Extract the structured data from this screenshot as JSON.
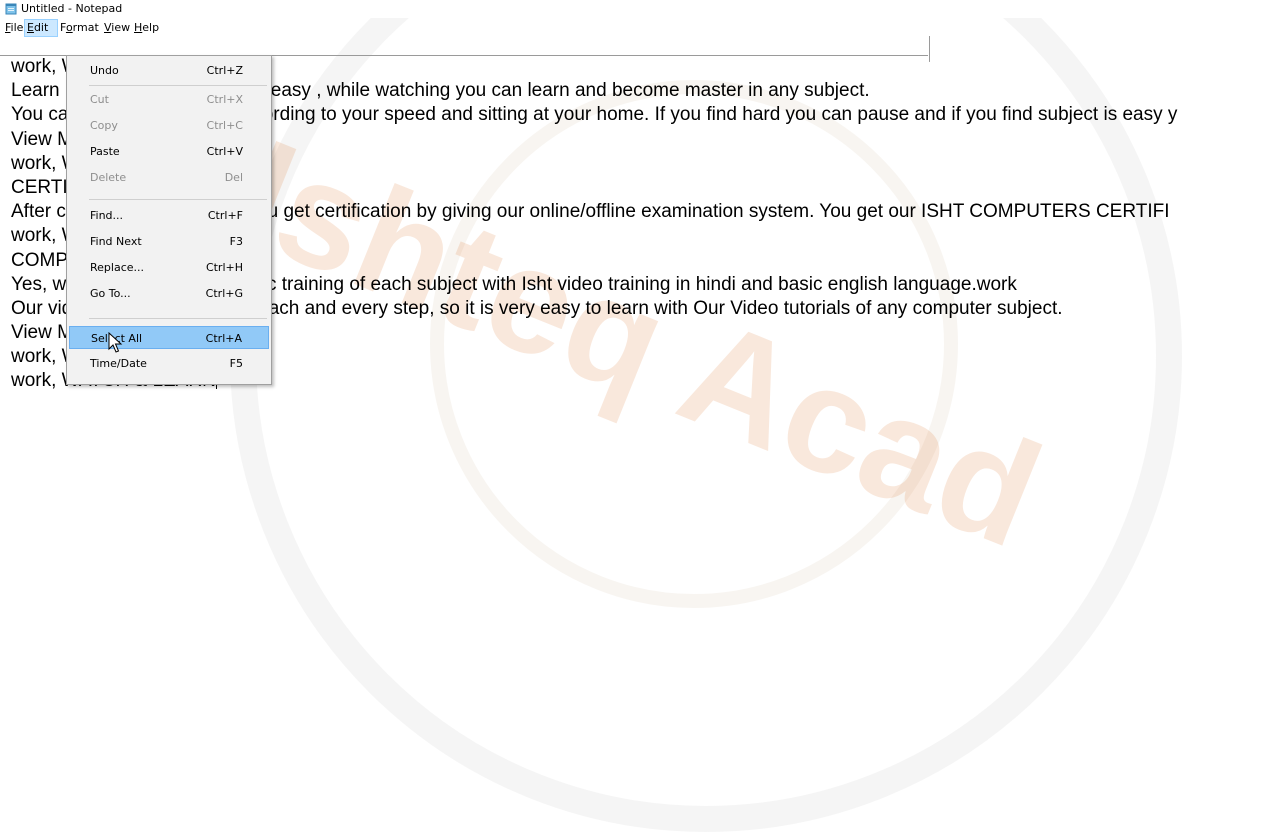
{
  "window": {
    "title": "Untitled - Notepad"
  },
  "menubar": {
    "items": [
      {
        "label": "File",
        "key": "file"
      },
      {
        "label": "Edit",
        "key": "edit"
      },
      {
        "label": "Format",
        "key": "format"
      },
      {
        "label": "View",
        "key": "view"
      },
      {
        "label": "Help",
        "key": "help"
      }
    ],
    "active": "Edit"
  },
  "edit_menu": {
    "items": [
      {
        "label": "Undo",
        "shortcut": "Ctrl+Z",
        "enabled": true
      },
      {
        "label": "Cut",
        "shortcut": "Ctrl+X",
        "enabled": false
      },
      {
        "label": "Copy",
        "shortcut": "Ctrl+C",
        "enabled": false
      },
      {
        "label": "Paste",
        "shortcut": "Ctrl+V",
        "enabled": true
      },
      {
        "label": "Delete",
        "shortcut": "Del",
        "enabled": false
      },
      {
        "label": "Find...",
        "shortcut": "Ctrl+F",
        "enabled": true
      },
      {
        "label": "Find Next",
        "shortcut": "F3",
        "enabled": true
      },
      {
        "label": "Replace...",
        "shortcut": "Ctrl+H",
        "enabled": true
      },
      {
        "label": "Go To...",
        "shortcut": "Ctrl+G",
        "enabled": true
      },
      {
        "label": "Select All",
        "shortcut": "Ctrl+A",
        "enabled": true,
        "highlighted": true
      },
      {
        "label": "Time/Date",
        "shortcut": "F5",
        "enabled": true
      }
    ]
  },
  "editor": {
    "lines": [
      "work, WATCH & LEARN",
      "Learn by watching videos. It is easy , while watching you can learn and become master in any subject.",
      "You can learn any subject according to your speed and sitting at your home. If you find hard you can pause and if you find subject is easy y",
      "View More",
      "work, WATCH & LEARN",
      "CERTIFICATION",
      "After completing the course you get certification by giving our online/offline examination system. You get our ISHT COMPUTERS CERTIFI",
      "work, WATCH & LEARN",
      "COMPLETE TRAINING",
      "Yes, we provide complete basic training of each subject with Isht video training in hindi and basic english language.work",
      "Our video tutorials guide you each and every step, so it is very easy to learn with Our Video tutorials of any computer subject.",
      "View More",
      "work, WATCH & LEARN",
      "work, WATCH & LEARN"
    ]
  },
  "watermark": {
    "text": "Ishteq Acad",
    "color": "#dc6e28"
  }
}
